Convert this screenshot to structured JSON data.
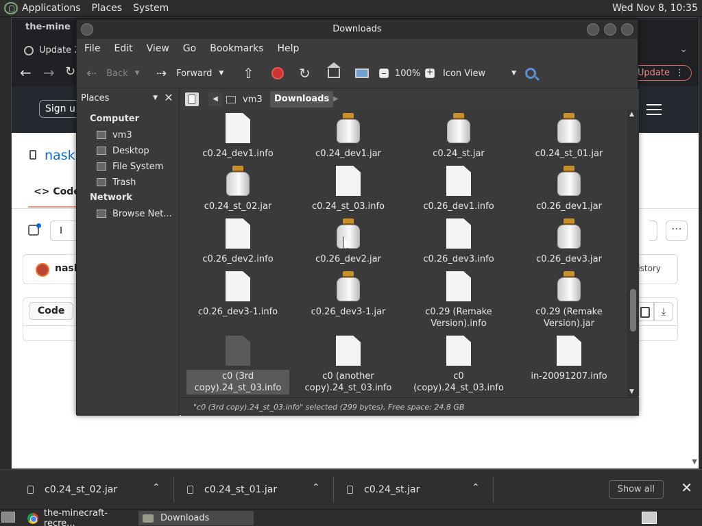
{
  "top_panel": {
    "menus": [
      "Applications",
      "Places",
      "System"
    ],
    "clock": "Wed Nov 8, 10:35"
  },
  "browser": {
    "tab_title": "the-mine",
    "update_text": "Update 2",
    "update_button": "Update",
    "signup": "Sign up",
    "repo_name": "nask",
    "code_tab": "Code",
    "commit_user": "nask",
    "history": "History",
    "code_button": "Code"
  },
  "nautilus": {
    "title": "Downloads",
    "menus": [
      "File",
      "Edit",
      "View",
      "Go",
      "Bookmarks",
      "Help"
    ],
    "toolbar": {
      "back": "Back",
      "forward": "Forward",
      "zoom": "100%",
      "view_mode": "Icon View"
    },
    "side_pane": {
      "selector": "Places",
      "groups": [
        {
          "header": "Computer",
          "items": [
            "vm3",
            "Desktop",
            "File System",
            "Trash"
          ]
        },
        {
          "header": "Network",
          "items": [
            "Browse Net..."
          ]
        }
      ]
    },
    "path": {
      "home": "vm3",
      "current": "Downloads"
    },
    "files": [
      {
        "label": "c0.24_dev1.info",
        "kind": "doc"
      },
      {
        "label": "c0.24_dev1.jar",
        "kind": "jar"
      },
      {
        "label": "c0.24_st.jar",
        "kind": "jar"
      },
      {
        "label": "c0.24_st_01.jar",
        "kind": "jar"
      },
      {
        "label": "c0.24_st_02.jar",
        "kind": "jar"
      },
      {
        "label": "c0.24_st_03.info",
        "kind": "doc"
      },
      {
        "label": "c0.26_dev1.info",
        "kind": "doc"
      },
      {
        "label": "c0.26_dev1.jar",
        "kind": "jar"
      },
      {
        "label": "c0.26_dev2.info",
        "kind": "doc"
      },
      {
        "label": "c0.26_dev2.jar",
        "kind": "jar"
      },
      {
        "label": "c0.26_dev3.info",
        "kind": "doc"
      },
      {
        "label": "c0.26_dev3.jar",
        "kind": "jar"
      },
      {
        "label": "c0.26_dev3-1.info",
        "kind": "doc"
      },
      {
        "label": "c0.26_dev3-1.jar",
        "kind": "jar"
      },
      {
        "label": "c0.29 (Remake Version).info",
        "kind": "doc"
      },
      {
        "label": "c0.29 (Remake Version).jar",
        "kind": "jar"
      },
      {
        "label": "c0 (3rd copy).24_st_03.info",
        "kind": "doc",
        "selected": true
      },
      {
        "label": "c0 (another copy).24_st_03.info",
        "kind": "doc"
      },
      {
        "label": "c0 (copy).24_st_03.info",
        "kind": "doc"
      },
      {
        "label": "in-20091207.info",
        "kind": "doc"
      }
    ],
    "status": "\"c0 (3rd copy).24_st_03.info\" selected (299 bytes), Free space: 24.8 GB"
  },
  "downloads_shelf": {
    "items": [
      "c0.24_st_02.jar",
      "c0.24_st_01.jar",
      "c0.24_st.jar"
    ],
    "show_all": "Show all"
  },
  "taskbar": {
    "tasks": [
      "the-minecraft-recre...",
      "Downloads"
    ]
  }
}
